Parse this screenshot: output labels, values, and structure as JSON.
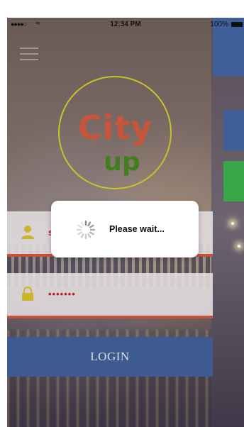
{
  "status_bar": {
    "signal": "●●●●○",
    "time": "12:34 PM",
    "battery": "100%"
  },
  "logo": {
    "line1": "City",
    "line2": "up"
  },
  "login_form": {
    "username_value": "s",
    "password_value": "•••••••",
    "login_label": "LOGIN"
  },
  "loading_dialog": {
    "message": "Please wait..."
  },
  "colors": {
    "accent_red": "#c6513a",
    "login_blue": "#3e5b91",
    "side_green": "#3aa64a",
    "logo_ring": "#c9c12a"
  },
  "icons": [
    "menu-icon",
    "user-icon",
    "lock-icon",
    "spinner-icon",
    "wifi-icon",
    "battery-icon"
  ]
}
